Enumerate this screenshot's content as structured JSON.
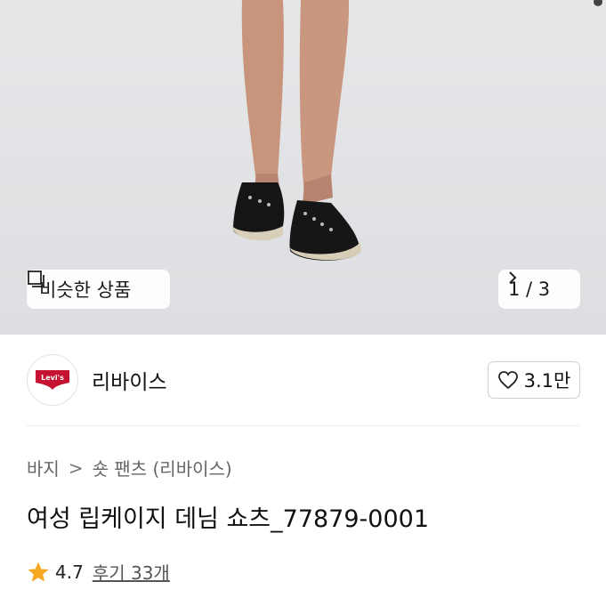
{
  "hero": {
    "similar_label": "비슷한 상품",
    "pager_text": "1 / 3"
  },
  "brand": {
    "logo_text": "Levi's",
    "name": "리바이스",
    "likes": "3.1만"
  },
  "breadcrumb": {
    "items": [
      "바지",
      "숏 팬츠 (리바이스)"
    ],
    "separator": ">"
  },
  "product": {
    "title": "여성 립케이지 데님 쇼츠_77879-0001"
  },
  "rating": {
    "score": "4.7",
    "reviews": "후기 33개"
  },
  "colors": {
    "accent_star": "#f7a823",
    "logo_red": "#c41230"
  }
}
